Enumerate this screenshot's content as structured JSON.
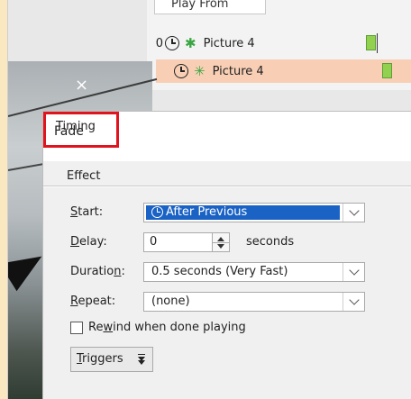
{
  "pane": {
    "play_from_label": "Play From",
    "rows": [
      {
        "number": "0",
        "label": "Picture 4"
      },
      {
        "number": "",
        "label": "Picture 4"
      }
    ],
    "bar_color": "#92d050",
    "selected_row_color": "#f8cfb5"
  },
  "slide": {
    "close_glyph": "×"
  },
  "dialog": {
    "title": "Fade",
    "tabs": {
      "effect": "Effect",
      "timing": "Timing"
    },
    "highlight_color": "#e0141e",
    "start": {
      "label_pre": "",
      "label_u": "S",
      "label_post": "tart:",
      "value": "After Previous",
      "highlight": "#1a62c4"
    },
    "delay": {
      "label_u": "D",
      "label_post": "elay:",
      "value": "0",
      "unit": "seconds"
    },
    "duration": {
      "label_pre": "Duratio",
      "label_u": "n",
      "label_post": ":",
      "value": "0.5 seconds (Very Fast)"
    },
    "repeat": {
      "label_u": "R",
      "label_post": "epeat:",
      "value": "(none)"
    },
    "rewind": {
      "label_pre": "Re",
      "label_u": "w",
      "label_post": "ind when done playing",
      "checked": false
    },
    "triggers": {
      "label_u": "T",
      "label_post": "riggers"
    }
  }
}
